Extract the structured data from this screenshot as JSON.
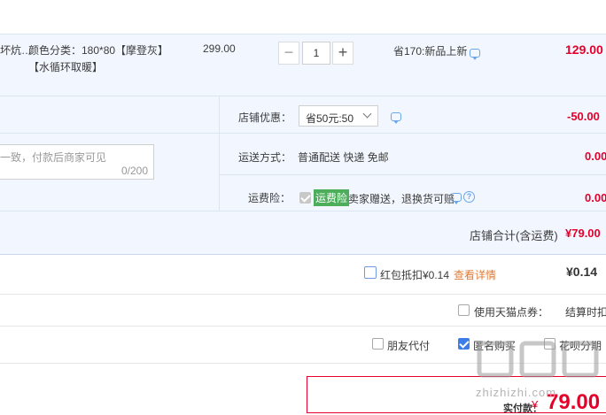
{
  "item": {
    "title_fragment": "坏炕…",
    "sku_line1": "颜色分类：180*80【摩登灰】",
    "sku_line2": "【水循环取暖】",
    "unit_price": "299.00",
    "quantity": "1",
    "promo": "省170:新品上新",
    "subtotal": "129.00"
  },
  "shop": {
    "discount_label": "店铺优惠：",
    "discount_select": "省50元:50",
    "discount_amount": "-50.00",
    "message_placeholder": "一致，付款后商家可见",
    "message_counter": "0/200",
    "delivery_label": "运送方式：",
    "delivery_value": "普通配送 快递 免邮",
    "delivery_amount": "0.00",
    "insurance_label": "运费险：",
    "insurance_badge": "运费险",
    "insurance_text": "卖家赠送，退换货可赔",
    "insurance_amount": "0.00",
    "total_label": "店铺合计(含运费)",
    "total_value": "¥79.00"
  },
  "redpacket": {
    "label": "红包抵扣¥0.14",
    "link": "查看详情",
    "amount": "¥0.14"
  },
  "tmall_points": {
    "label": "使用天猫点券：",
    "right_text": "结算时扣除"
  },
  "options": {
    "friend_pay": "朋友代付",
    "anonymous": "匿名购买",
    "anonymous_checked": true,
    "huabei": "花呗分期"
  },
  "payable": {
    "label": "实付款：",
    "currency": "¥",
    "amount": "79.00"
  },
  "watermark": "zhizhizhi.com",
  "colors": {
    "price_red": "#e4002b",
    "panel_bg": "#f2f7ff",
    "link_orange": "#e07b34",
    "badge_green": "#4cad5b"
  }
}
